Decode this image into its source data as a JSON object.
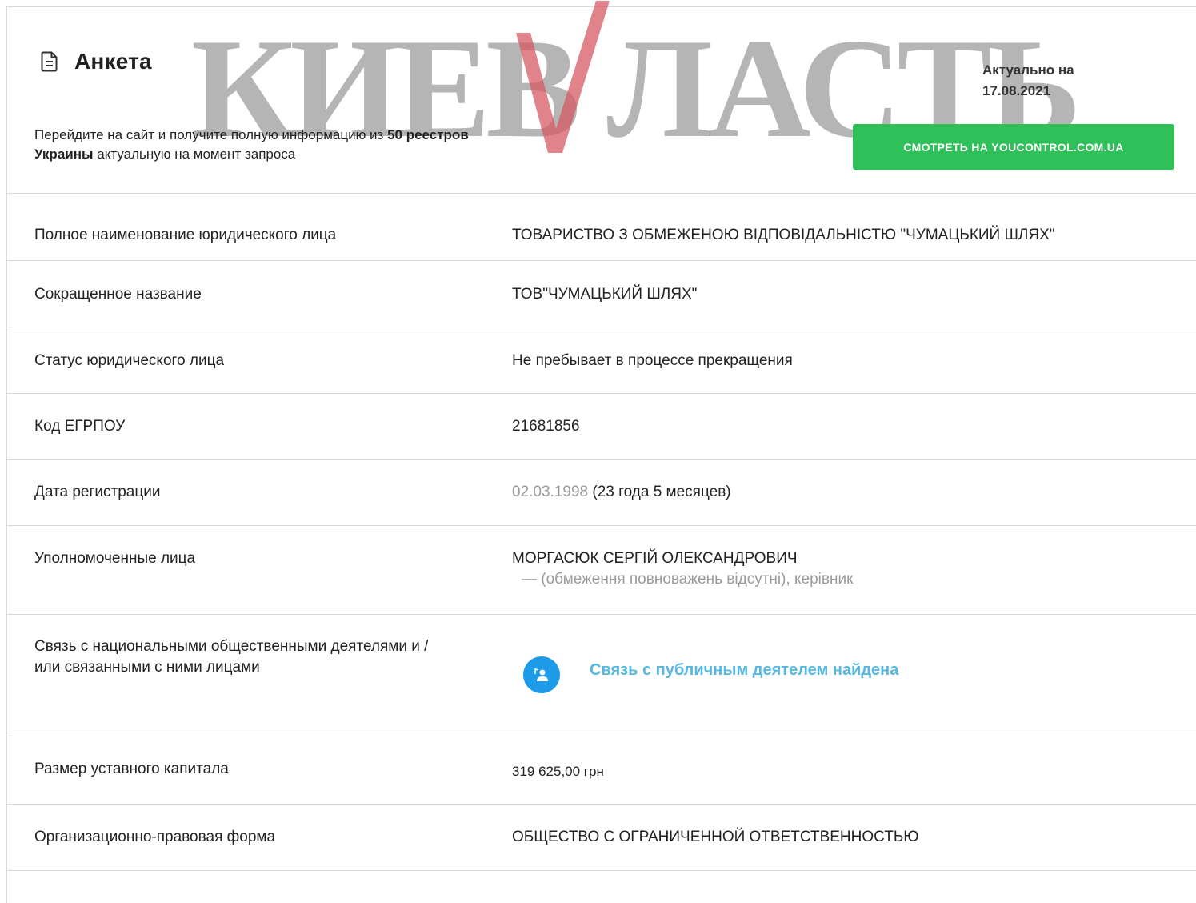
{
  "header": {
    "title": "Анкета",
    "watermark": "КИЕВВЛАСТЬ",
    "actual_label": "Актуально на",
    "actual_date": "17.08.2021",
    "promo_prefix": "Перейдите на сайт и получите полную информацию из ",
    "promo_bold": "50 реестров Украины",
    "promo_suffix": " актуальную на момент запроса",
    "button_label": "СМОТРЕТЬ НА YOUCONTROL.COM.UA",
    "button_color": "#2fc05a"
  },
  "rows": [
    {
      "label": "Полное наименование юридического лица",
      "value": "ТОВАРИСТВО З ОБМЕЖЕНОЮ ВІДПОВІДАЛЬНІСТЮ \"ЧУМАЦЬКИЙ ШЛЯХ\""
    },
    {
      "label": "Сокращенное название",
      "value": "ТОВ\"ЧУМАЦЬКИЙ ШЛЯХ\""
    },
    {
      "label": "Статус юридического лица",
      "value": "Не пребывает в процессе прекращения"
    },
    {
      "label": "Код ЕГРПОУ",
      "value": "21681856"
    },
    {
      "label": "Дата регистрации",
      "date": "02.03.1998",
      "age": " (23 года 5 месяцев)"
    },
    {
      "label": "Уполномоченные лица",
      "value": "МОРГАСЮК СЕРГІЙ ОЛЕКСАНДРОВИЧ",
      "note": "— (обмеження повноважень відсутні), керівник"
    },
    {
      "label": "Связь с национальными общественными деятелями и / или связанными с ними лицами",
      "value": "Связь с публичным деятелем найдена",
      "icon": "public-figure-icon"
    },
    {
      "label": "Размер уставного капитала",
      "value": "319 625,00 грн"
    },
    {
      "label": "Организационно-правовая форма",
      "value": "ОБЩЕСТВО С ОГРАНИЧЕННОЙ ОТВЕТСТВЕННОСТЬЮ"
    }
  ]
}
